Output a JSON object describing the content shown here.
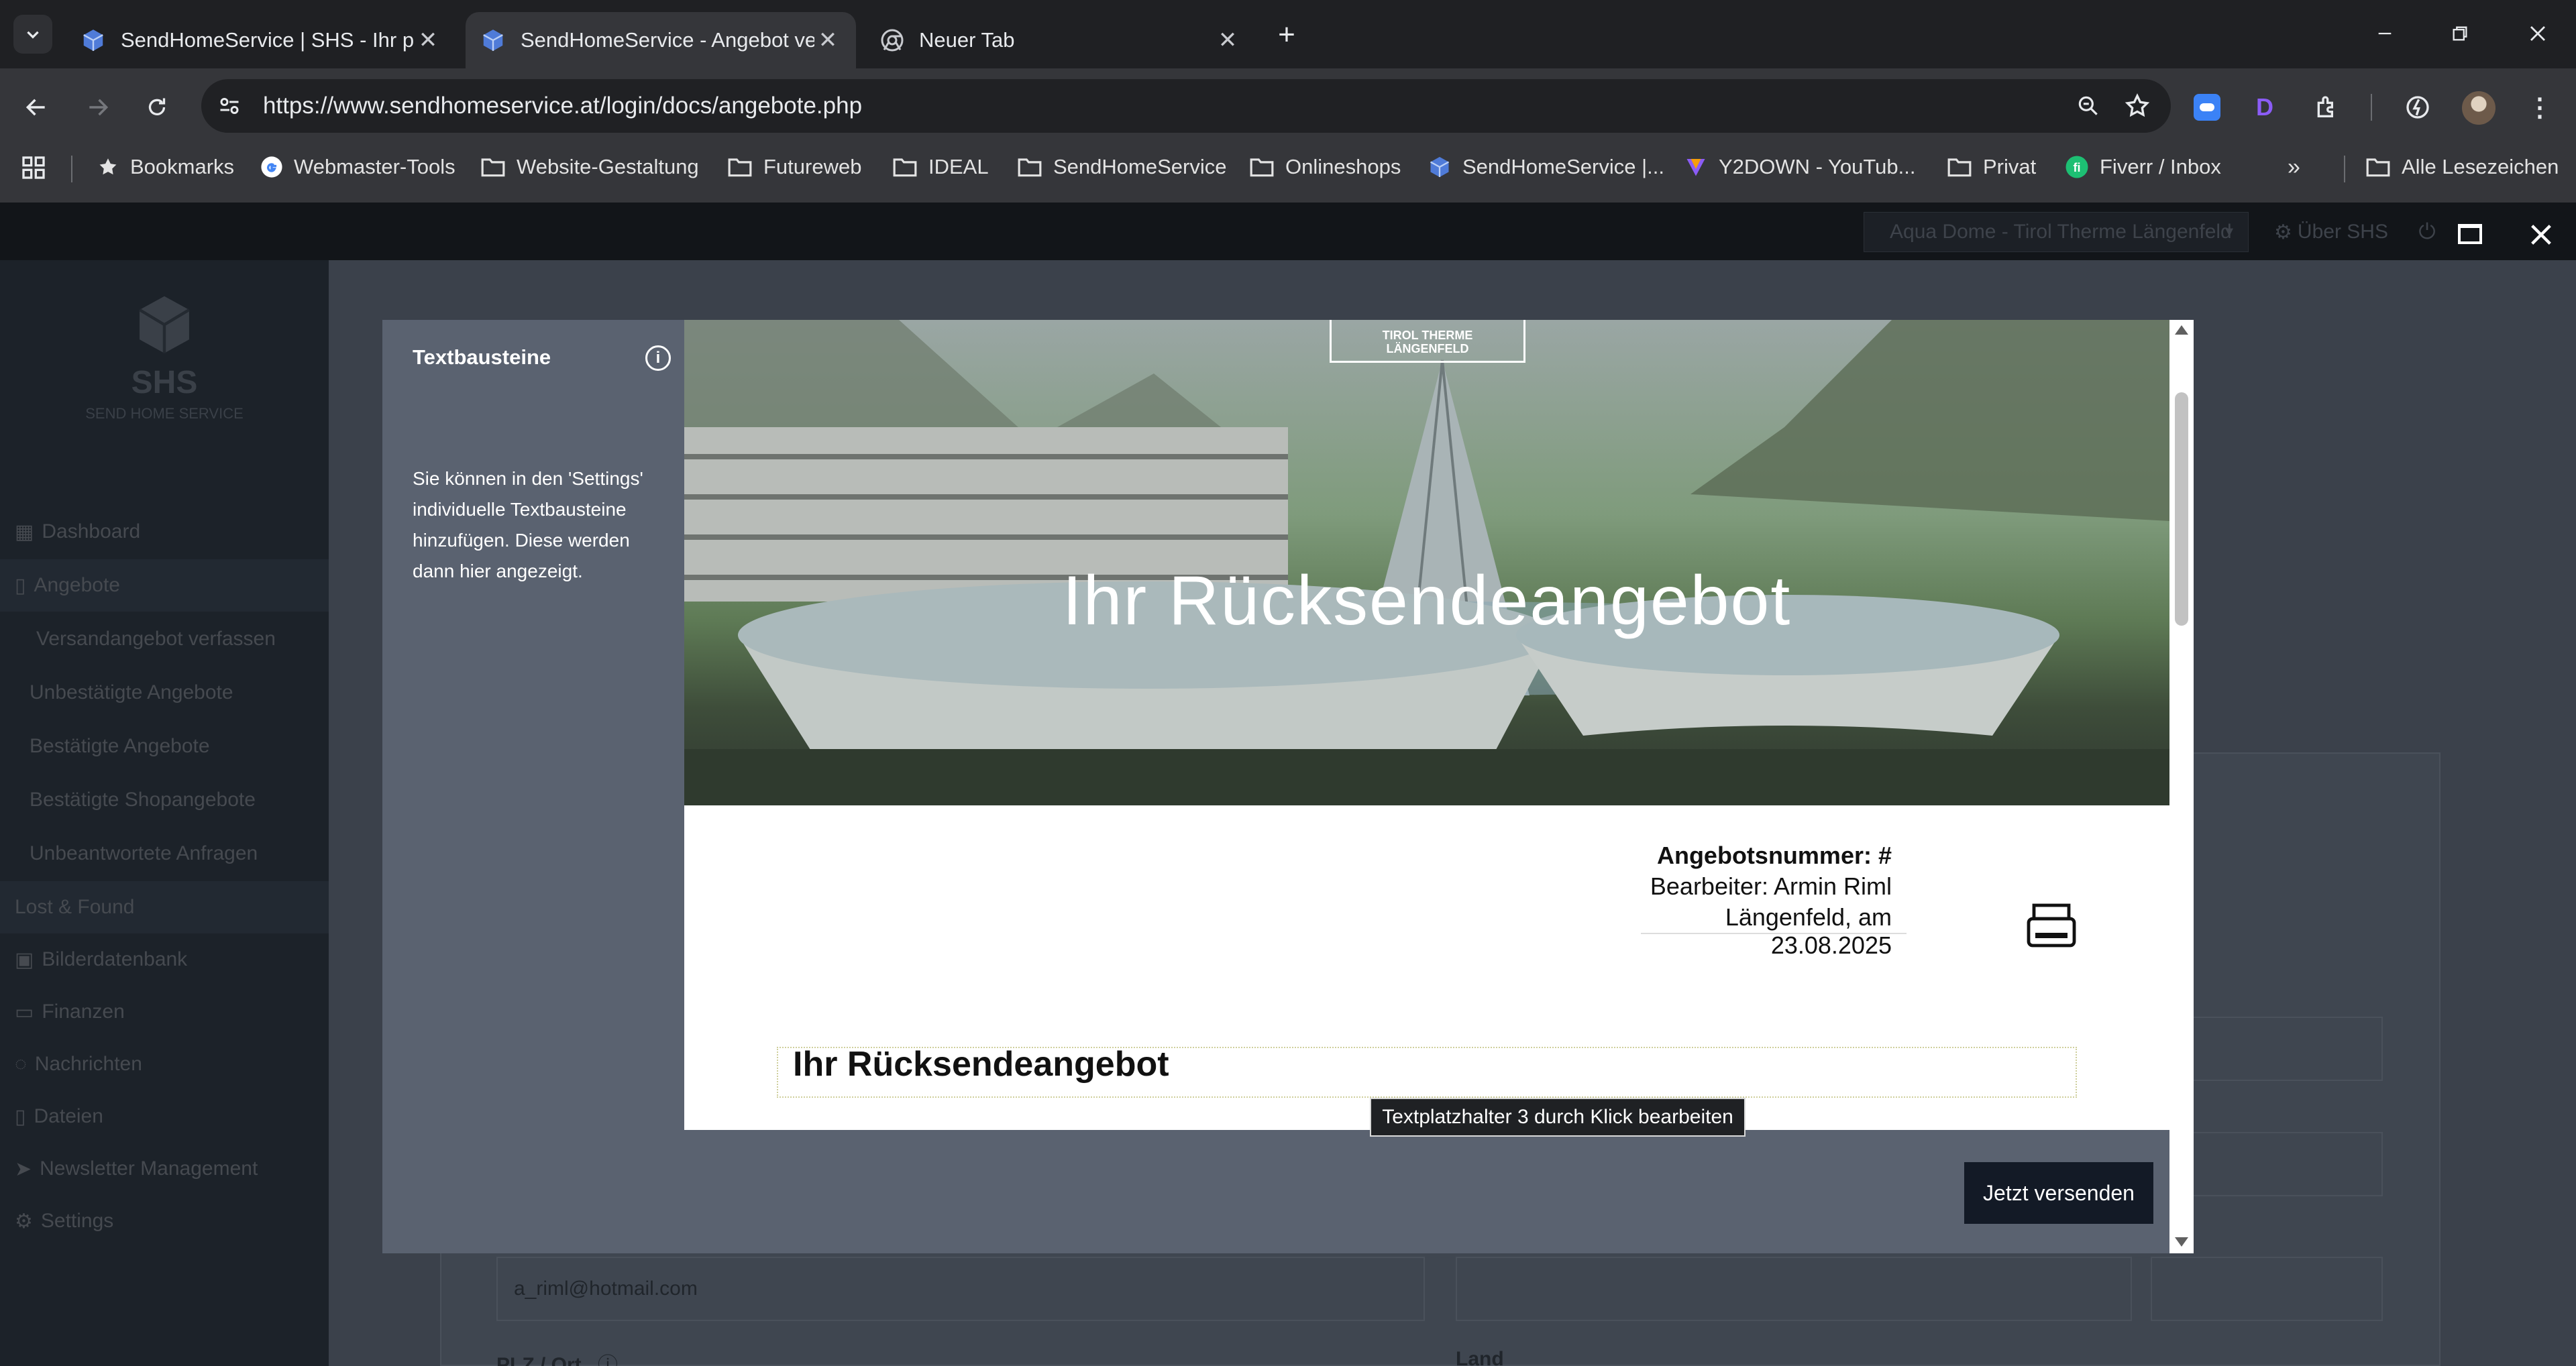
{
  "browser": {
    "tabs": [
      {
        "title": "SendHomeService | SHS - Ihr pr"
      },
      {
        "title": "SendHomeService - Angebot ve"
      },
      {
        "title": "Neuer Tab"
      }
    ],
    "url": "https://www.sendhomeservice.at/login/docs/angebote.php"
  },
  "bookmarks": {
    "items": [
      {
        "label": "Bookmarks",
        "icon": "star-icon"
      },
      {
        "label": "Webmaster-Tools",
        "icon": "google-icon"
      },
      {
        "label": "Website-Gestaltung",
        "icon": "folder-icon"
      },
      {
        "label": "Futureweb",
        "icon": "folder-icon"
      },
      {
        "label": "IDEAL",
        "icon": "folder-icon"
      },
      {
        "label": "SendHomeService",
        "icon": "folder-icon"
      },
      {
        "label": "Onlineshops",
        "icon": "folder-icon"
      },
      {
        "label": "SendHomeService |...",
        "icon": "cube-icon"
      },
      {
        "label": "Y2DOWN - YouTub...",
        "icon": "y2down-icon"
      },
      {
        "label": "Privat",
        "icon": "folder-icon"
      },
      {
        "label": "Fiverr / Inbox",
        "icon": "fiverr-icon"
      }
    ],
    "all_label": "Alle Lesezeichen"
  },
  "app": {
    "hotel_select": "Aqua Dome - Tirol Therme Längenfeld",
    "about": "Über SHS",
    "logo_text": "SHS",
    "logo_sub": "SEND HOME SERVICE",
    "nav": {
      "dashboard": "Dashboard",
      "angebote": "Angebote",
      "versand": "Versandangebot verfassen",
      "unbestaetigt": "Unbestätigte Angebote",
      "bestaetigt": "Bestätigte Angebote",
      "shop": "Bestätigte Shopangebote",
      "anfragen": "Unbeantwortete Anfragen",
      "lost": "Lost & Found",
      "bilder": "Bilderdatenbank",
      "finanzen": "Finanzen",
      "nachrichten": "Nachrichten",
      "dateien": "Dateien",
      "newsletter": "Newsletter Management",
      "settings": "Settings"
    },
    "email": "a_riml@hotmail.com",
    "plz_label": "PLZ / Ort",
    "land_label": "Land"
  },
  "modal": {
    "sidebar_title": "Textbausteine",
    "sidebar_text": "Sie können in den 'Settings' individuelle Textbausteine hinzufügen. Diese werden dann hier angezeigt.",
    "hero_logo": "TIROL THERME LÄNGENFELD",
    "hero_title": "Ihr Rücksendeangebot",
    "offer_number": "Angebotsnummer: #",
    "editor": "Bearbeiter: Armin Riml",
    "date_line": "Längenfeld, am 23.08.2025",
    "heading": "Ihr Rücksendeangebot",
    "tooltip": "Textplatzhalter 3 durch Klick bearbeiten",
    "send_button": "Jetzt versenden"
  }
}
